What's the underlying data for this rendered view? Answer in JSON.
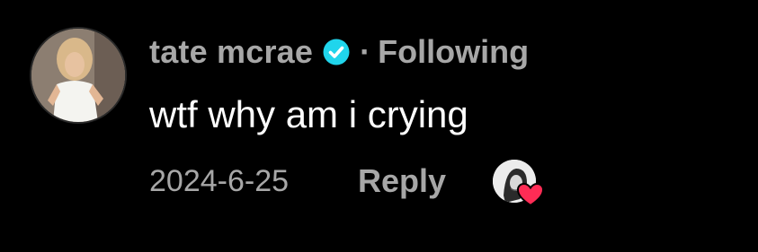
{
  "comment": {
    "author": {
      "username": "tate mcrae",
      "verified_icon": "verified-badge-icon",
      "separator": "·",
      "follow_status": "Following",
      "avatar": "profile-photo"
    },
    "text": "wtf why am i crying",
    "date": "2024-6-25",
    "reply_label": "Reply",
    "liked_by_creator": {
      "avatar": "creator-avatar",
      "heart_icon": "heart-icon"
    }
  },
  "colors": {
    "background": "#000000",
    "muted_text": "#a7a7a7",
    "comment_text": "#ffffff",
    "verified_blue": "#20d5ec",
    "heart_red": "#fe2c55"
  }
}
